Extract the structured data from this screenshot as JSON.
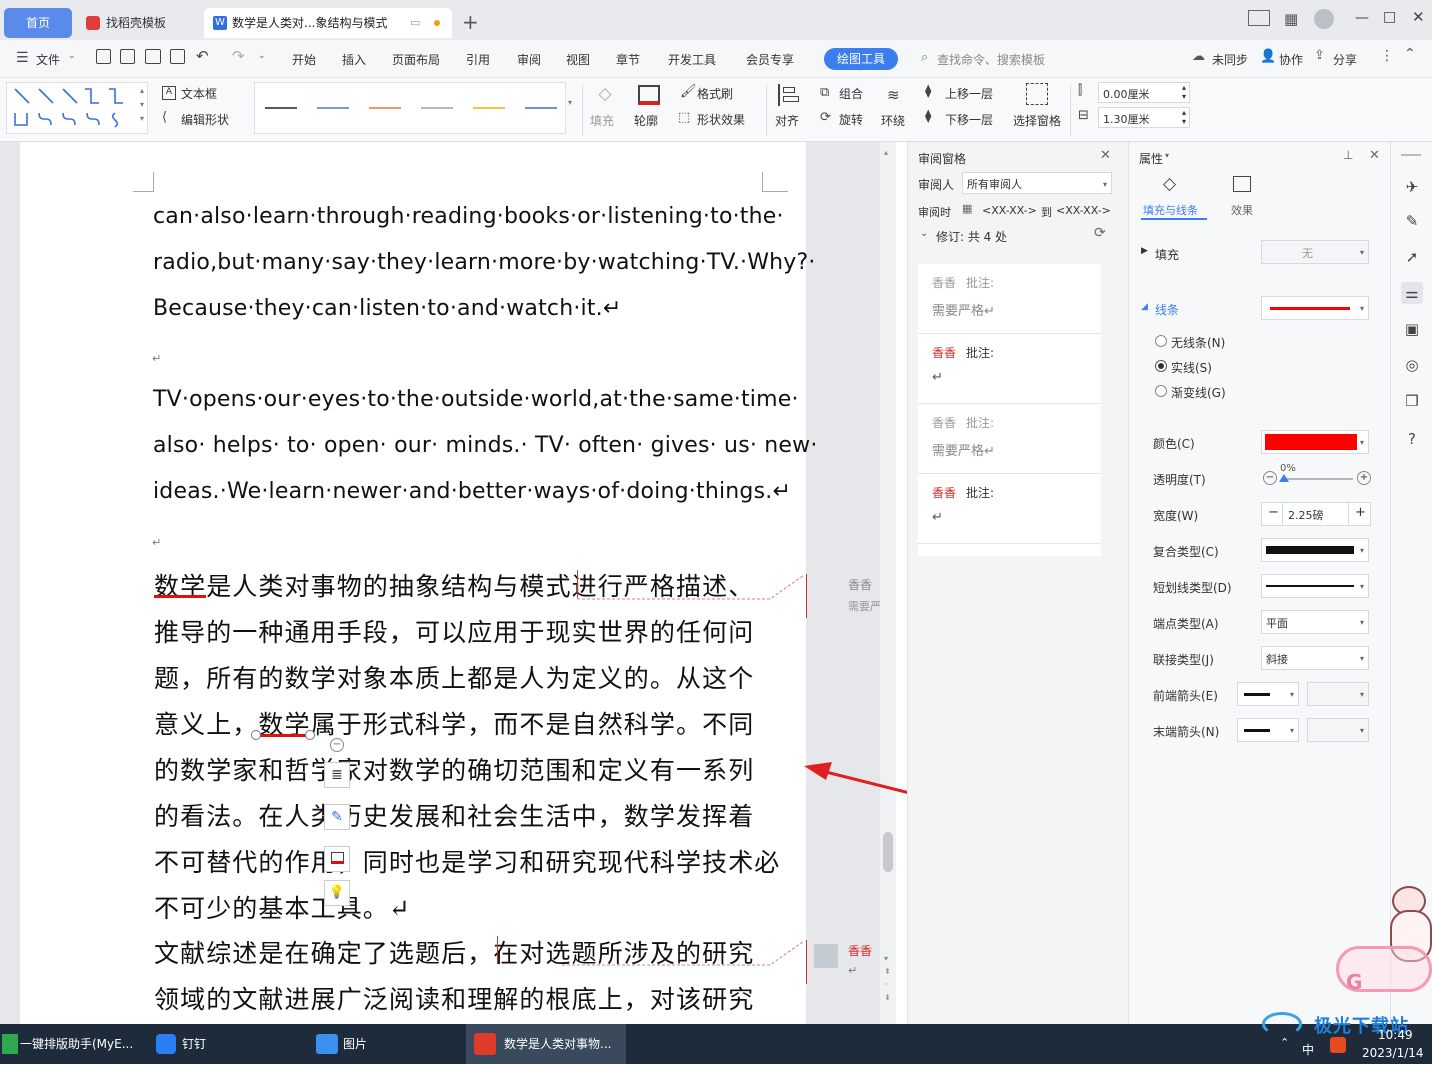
{
  "tabs": {
    "home": "首页",
    "template": "找稻壳模板",
    "doc": "数学是人类对...象结构与模式"
  },
  "menu": {
    "file": "文件",
    "items": [
      "开始",
      "插入",
      "页面布局",
      "引用",
      "审阅",
      "视图",
      "章节",
      "开发工具",
      "会员专享"
    ],
    "active": "绘图工具",
    "search_placeholder": "查找命令、搜索模板",
    "unsynced": "未同步",
    "collab": "协作",
    "share": "分享"
  },
  "ribbon": {
    "textbox": "文本框",
    "edit_shape": "编辑形状",
    "fill": "填充",
    "outline": "轮廓",
    "format_brush": "格式刷",
    "shape_effect": "形状效果",
    "align": "对齐",
    "group": "组合",
    "rotate": "旋转",
    "wrap": "环绕",
    "bring_forward": "上移一层",
    "send_backward": "下移一层",
    "select_pane": "选择窗格",
    "height_value": "0.00厘米",
    "width_value": "1.30厘米",
    "line_colors": [
      "#222222",
      "#4a7bd0",
      "#e07b28",
      "#a0a0a0",
      "#f0b400",
      "#3a6fd8"
    ]
  },
  "document": {
    "en_lines": [
      "can·also·learn·through·reading·books·or·listening·to·the·",
      "radio,but·many·say·they·learn·more·by·watching·TV.·Why?·",
      "Because·they·can·listen·to·and·watch·it.↵",
      "TV·opens·our·eyes·to·the·outside·world,at·the·same·time·",
      "also· helps· to· open· our· minds.· TV· often· gives· us· new·",
      "ideas.·We·learn·newer·and·better·ways·of·doing·things.↵"
    ],
    "para_mark": "↵",
    "zh_lines": [
      "数学是人类对事物的抽象结构与模式进行严格描述、",
      "推导的一种通用手段，可以应用于现实世界的任何问",
      "题，所有的数学对象本质上都是人为定义的。从这个",
      "意义上，数学属于形式科学，而不是自然科学。不同",
      "的数学家和哲学家对数学的确切范围和定义有一系列",
      "的看法。在人类历史发展和社会生活中，数学发挥着",
      "不可替代的作用，同时也是学习和研究现代科学技术必",
      "不可少的基本工具。↵",
      "文献综述是在确定了选题后，在对选题所涉及的研究",
      "领域的文献进展广泛阅读和理解的根底上，对该研究"
    ],
    "margin_comments": [
      {
        "author": "香香",
        "text": "需要严"
      },
      {
        "author": "香香",
        "text": "↵"
      }
    ]
  },
  "review_pane": {
    "title": "审阅窗格",
    "reviewer_label": "审阅人",
    "reviewer_value": "所有审阅人",
    "time_label": "审阅时",
    "time_from": "<XX-XX->",
    "time_to_label": "到",
    "time_to": "<XX-XX->",
    "revisions": "修订:  共 4 处",
    "comments": [
      {
        "author": "香香",
        "kind": "批注:",
        "text": "需要严格↵",
        "active": false
      },
      {
        "author": "香香",
        "kind": "批注:",
        "text": "↵",
        "active": true
      },
      {
        "author": "香香",
        "kind": "批注:",
        "text": "需要严格↵",
        "active": false
      },
      {
        "author": "香香",
        "kind": "批注:",
        "text": "↵",
        "active": true
      }
    ]
  },
  "props": {
    "title": "属性",
    "tab_fill_line": "填充与线条",
    "tab_effect": "效果",
    "fill_label": "填充",
    "fill_value": "无",
    "line_label": "线条",
    "radio_none": "无线条(N)",
    "radio_solid": "实线(S)",
    "radio_gradient": "渐变线(G)",
    "color_label": "颜色(C)",
    "line_color": "#ff0000",
    "transparency_label": "透明度(T)",
    "transparency_value": "0%",
    "width_label": "宽度(W)",
    "width_value": "2.25磅",
    "compound_label": "复合类型(C)",
    "dash_label": "短划线类型(D)",
    "cap_label": "端点类型(A)",
    "cap_value": "平面",
    "join_label": "联接类型(J)",
    "join_value": "斜接",
    "begin_arrow_label": "前端箭头(E)",
    "end_arrow_label": "末端箭头(N)"
  },
  "taskbar": {
    "items": [
      "一键排版助手(MyE...",
      "钉钉",
      "图片",
      "数学是人类对事物..."
    ],
    "ime": "中",
    "time": "10:49",
    "date": "2023/1/14",
    "watermark": "极光下载站"
  }
}
